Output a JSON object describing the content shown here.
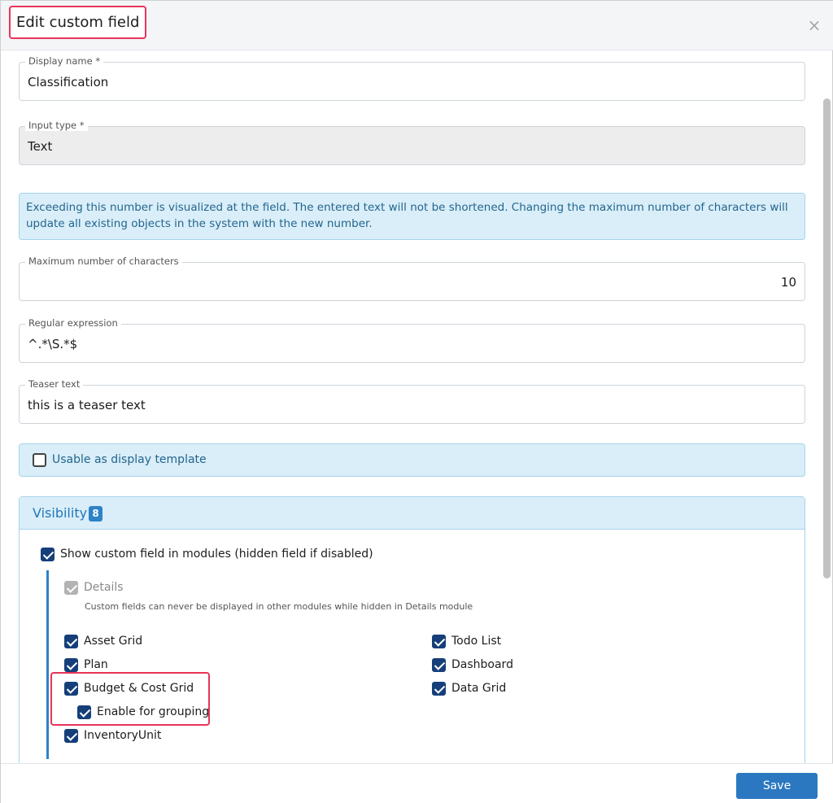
{
  "dialog": {
    "title": "Edit custom field",
    "close_glyph": "×"
  },
  "fields": {
    "display_name": {
      "label": "Display name *",
      "value": "Classification"
    },
    "input_type": {
      "label": "Input type *",
      "value": "Text"
    },
    "info_text": "Exceeding this number is visualized at the field. The entered text will not be shortened. Changing the maximum number of characters will update all existing objects in the system with the new number.",
    "max_chars": {
      "label": "Maximum number of characters",
      "value": "10"
    },
    "regex": {
      "label": "Regular expression",
      "value": "^.*\\S.*$"
    },
    "teaser": {
      "label": "Teaser text",
      "value": "this is a teaser text"
    }
  },
  "display_template": {
    "label": "Usable as display template",
    "checked": false
  },
  "visibility": {
    "title": "Visibility",
    "badge": "8",
    "show_in_modules": {
      "label": "Show custom field in modules (hidden field if disabled)",
      "checked": true
    },
    "details": {
      "label": "Details",
      "checked": true,
      "disabled": true,
      "help": "Custom fields can never be displayed in other modules while hidden in Details module"
    },
    "modules_left": [
      {
        "label": "Asset Grid",
        "checked": true
      },
      {
        "label": "Plan",
        "checked": true
      },
      {
        "label": "Budget & Cost Grid",
        "checked": true
      },
      {
        "label": "Enable for grouping",
        "checked": true
      },
      {
        "label": "InventoryUnit",
        "checked": true
      }
    ],
    "modules_right": [
      {
        "label": "Todo List",
        "checked": true
      },
      {
        "label": "Dashboard",
        "checked": true
      },
      {
        "label": "Data Grid",
        "checked": true
      }
    ]
  },
  "footer": {
    "save_label": "Save"
  },
  "colors": {
    "accent": "#2b78c1",
    "highlight": "#e8355a",
    "info_bg": "#d9eef8",
    "checkbox": "#163f7a"
  }
}
